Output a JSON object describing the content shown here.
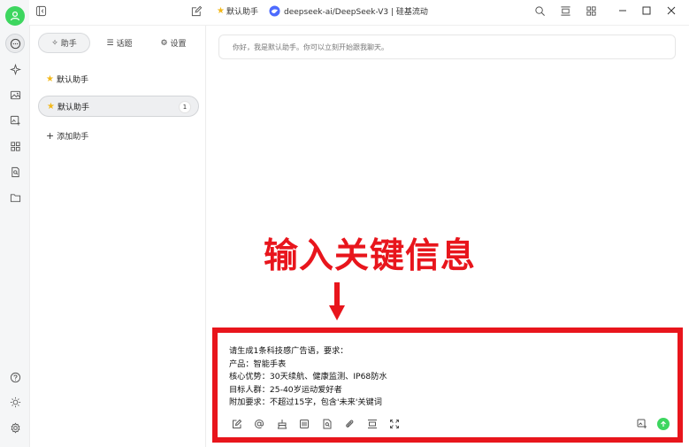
{
  "top": {
    "assistant_name": "默认助手",
    "model_label": "deepseek-ai/DeepSeek-V3 | 硅基流动"
  },
  "panel": {
    "tabs": [
      {
        "label": "助手",
        "icon": "sparkle-icon"
      },
      {
        "label": "话题",
        "icon": "list-icon"
      },
      {
        "label": "设置",
        "icon": "gear-icon"
      }
    ],
    "assistants": [
      {
        "label": "默认助手",
        "badge": ""
      },
      {
        "label": "默认助手",
        "badge": "1"
      }
    ],
    "add_label": "添加助手"
  },
  "chat": {
    "greeting": "你好，我是默认助手。你可以立刻开始跟我聊天。"
  },
  "annotation": {
    "text": "输入关键信息",
    "color": "#e8151c"
  },
  "input": {
    "lines": [
      "请生成1条科技感广告语，要求：",
      "产品：智能手表",
      "核心优势：30天续航、健康监测、IP68防水",
      "目标人群：25-40岁运动爱好者",
      "附加要求：不超过15字，包含'未来'关键词"
    ]
  },
  "colors": {
    "accent_green": "#3dd65f",
    "highlight_red": "#e8151c",
    "star": "#f3b81a"
  }
}
